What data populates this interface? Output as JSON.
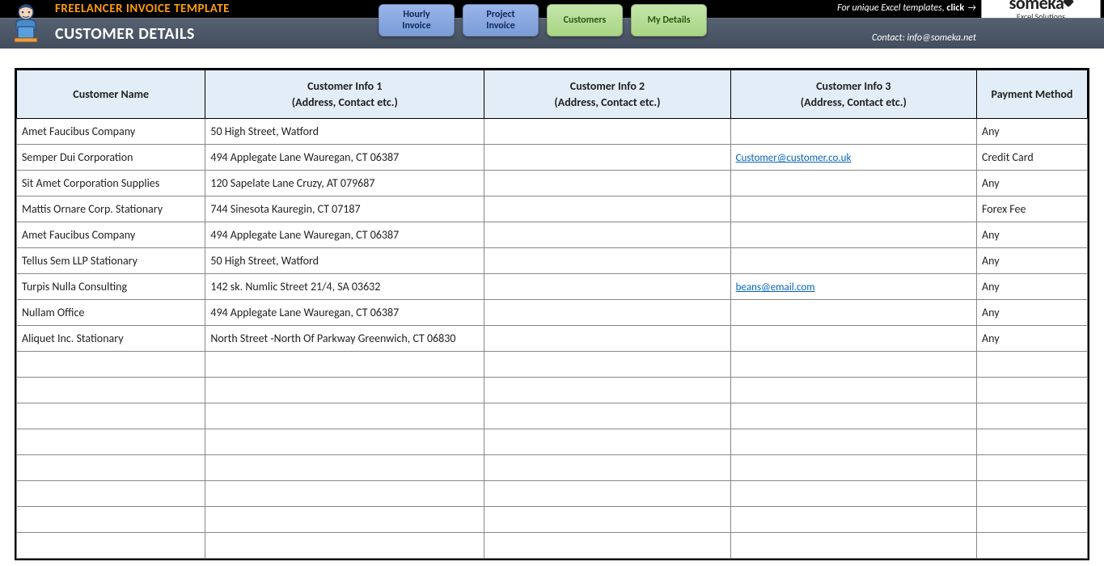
{
  "header": {
    "title": "FREELANCER INVOICE TEMPLATE",
    "promo_prefix": "For unique Excel templates, ",
    "promo_bold": "click",
    "contact": "Contact: info@someka.net"
  },
  "logo": {
    "main": "someka",
    "sub": "Excel Solutions"
  },
  "page": {
    "title": "CUSTOMER DETAILS"
  },
  "nav": {
    "hourly_l1": "Hourly",
    "hourly_l2": "Invoice",
    "project_l1": "Project",
    "project_l2": "Invoice",
    "customers": "Customers",
    "mydetails": "My Details"
  },
  "table": {
    "headers": {
      "name": "Customer Name",
      "info1_l1": "Customer Info 1",
      "info1_l2": "(Address, Contact etc.)",
      "info2_l1": "Customer Info 2",
      "info2_l2": "(Address, Contact etc.)",
      "info3_l1": "Customer Info 3",
      "info3_l2": "(Address, Contact etc.)",
      "payment": "Payment Method"
    },
    "rows": [
      {
        "name": "Amet Faucibus Company",
        "info1": "50 High Street, Watford",
        "info2": "",
        "info3": "",
        "info3_link": false,
        "payment": "Any"
      },
      {
        "name": "Semper Dui Corporation",
        "info1": "494 Applegate Lane Wauregan, CT 06387",
        "info2": "",
        "info3": "Customer@customer.co.uk",
        "info3_link": true,
        "payment": "Credit Card"
      },
      {
        "name": "Sit Amet Corporation Supplies",
        "info1": "120 Sapelate Lane Cruzy, AT 079687",
        "info2": "",
        "info3": "",
        "info3_link": false,
        "payment": "Any"
      },
      {
        "name": "Mattis Ornare Corp. Stationary",
        "info1": "744 Sinesota Kauregin, CT 07187",
        "info2": "",
        "info3": "",
        "info3_link": false,
        "payment": "Forex Fee"
      },
      {
        "name": "Amet Faucibus Company",
        "info1": "494 Applegate Lane Wauregan, CT 06387",
        "info2": "",
        "info3": "",
        "info3_link": false,
        "payment": "Any"
      },
      {
        "name": "Tellus Sem LLP Stationary",
        "info1": "50 High Street, Watford",
        "info2": "",
        "info3": "",
        "info3_link": false,
        "payment": "Any"
      },
      {
        "name": "Turpis Nulla Consulting",
        "info1": "142 sk. Numlic Street 21/4, SA 03632",
        "info2": "",
        "info3": "beans@email.com",
        "info3_link": true,
        "payment": "Any"
      },
      {
        "name": "Nullam Office",
        "info1": "494 Applegate Lane Wauregan, CT 06387",
        "info2": "",
        "info3": "",
        "info3_link": false,
        "payment": "Any"
      },
      {
        "name": "Aliquet Inc. Stationary",
        "info1": "North Street -North Of Parkway Greenwich, CT 06830",
        "info2": "",
        "info3": "",
        "info3_link": false,
        "payment": "Any"
      },
      {
        "name": "",
        "info1": "",
        "info2": "",
        "info3": "",
        "info3_link": false,
        "payment": ""
      },
      {
        "name": "",
        "info1": "",
        "info2": "",
        "info3": "",
        "info3_link": false,
        "payment": ""
      },
      {
        "name": "",
        "info1": "",
        "info2": "",
        "info3": "",
        "info3_link": false,
        "payment": ""
      },
      {
        "name": "",
        "info1": "",
        "info2": "",
        "info3": "",
        "info3_link": false,
        "payment": ""
      },
      {
        "name": "",
        "info1": "",
        "info2": "",
        "info3": "",
        "info3_link": false,
        "payment": ""
      },
      {
        "name": "",
        "info1": "",
        "info2": "",
        "info3": "",
        "info3_link": false,
        "payment": ""
      },
      {
        "name": "",
        "info1": "",
        "info2": "",
        "info3": "",
        "info3_link": false,
        "payment": ""
      },
      {
        "name": "",
        "info1": "",
        "info2": "",
        "info3": "",
        "info3_link": false,
        "payment": ""
      }
    ]
  }
}
